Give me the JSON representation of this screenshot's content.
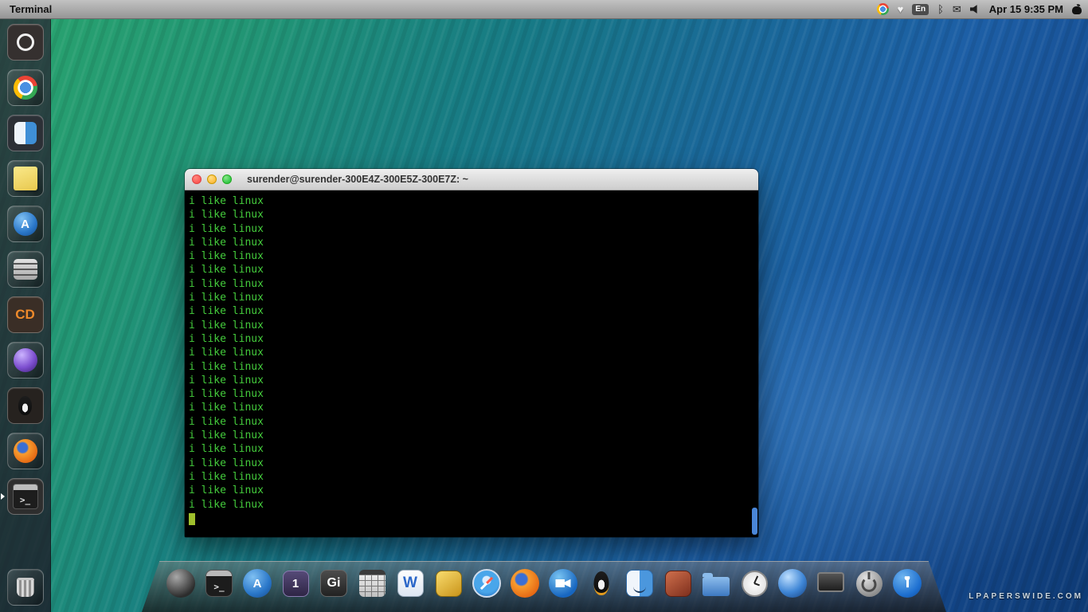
{
  "menu_bar": {
    "app_title": "Terminal",
    "keyboard_indicator": "En",
    "clock": "Apr 15 9:35 PM"
  },
  "launcher": {
    "items": [
      {
        "name": "dash-home-icon",
        "style": "lc-dash"
      },
      {
        "name": "chrome-icon",
        "style": "lc-chrome"
      },
      {
        "name": "finder-icon",
        "style": "lc-finder"
      },
      {
        "name": "sticky-notes-icon",
        "style": "lc-note"
      },
      {
        "name": "app-store-icon",
        "style": "lc-appstore",
        "glyph": "A"
      },
      {
        "name": "settings-icon",
        "style": "lc-settings"
      },
      {
        "name": "cd-burner-icon",
        "style": "lc-cd",
        "glyph": "CD"
      },
      {
        "name": "purple-orb-icon",
        "style": "lc-orb"
      },
      {
        "name": "tux-penguin-icon",
        "style": "lc-tux"
      },
      {
        "name": "firefox-icon",
        "style": "lc-firefox"
      },
      {
        "name": "terminal-icon",
        "style": "lc-term",
        "glyph": ">_",
        "extra": "running"
      }
    ]
  },
  "window": {
    "title": "surender@surender-300E4Z-300E5Z-300E7Z: ~",
    "lines": [
      "i like linux",
      "i like linux",
      "i like linux",
      "i like linux",
      "i like linux",
      "i like linux",
      "i like linux",
      "i like linux",
      "i like linux",
      "i like linux",
      "i like linux",
      "i like linux",
      "i like linux",
      "i like linux",
      "i like linux",
      "i like linux",
      "i like linux",
      "i like linux",
      "i like linux",
      "i like linux",
      "i like linux",
      "i like linux",
      "i like linux"
    ]
  },
  "dock": {
    "items": [
      {
        "name": "apple-icon",
        "style": "ic-apple"
      },
      {
        "name": "terminal-icon",
        "style": "ic-term2",
        "glyph": ">_"
      },
      {
        "name": "app-store-icon",
        "style": "ic-appstore",
        "glyph": "A"
      },
      {
        "name": "workspace-1-icon",
        "style": "ic-workspace",
        "glyph": "1"
      },
      {
        "name": "gimp-icon",
        "style": "ic-gimp",
        "glyph": "Gi"
      },
      {
        "name": "calculator-icon",
        "style": "ic-calc"
      },
      {
        "name": "writer-icon",
        "style": "ic-writer",
        "glyph": "W"
      },
      {
        "name": "gold-app-icon",
        "style": "ic-gold"
      },
      {
        "name": "safari-icon",
        "style": "ic-safari"
      },
      {
        "name": "firefox-icon",
        "style": "ic-firefox"
      },
      {
        "name": "video-chat-icon",
        "style": "ic-video"
      },
      {
        "name": "tux-penguin-icon",
        "style": "ic-penguin"
      },
      {
        "name": "finder-icon",
        "style": "ic-finder"
      },
      {
        "name": "home-icon",
        "style": "ic-home"
      },
      {
        "name": "folder-icon",
        "style": "ic-folder"
      },
      {
        "name": "clock-icon",
        "style": "ic-clock"
      },
      {
        "name": "blue-sphere-icon",
        "style": "ic-sphere"
      },
      {
        "name": "display-icon",
        "style": "ic-display"
      },
      {
        "name": "power-icon",
        "style": "ic-power"
      },
      {
        "name": "accessibility-icon",
        "style": "ic-access"
      }
    ]
  },
  "watermark": "LPAPERSWIDE.COM"
}
